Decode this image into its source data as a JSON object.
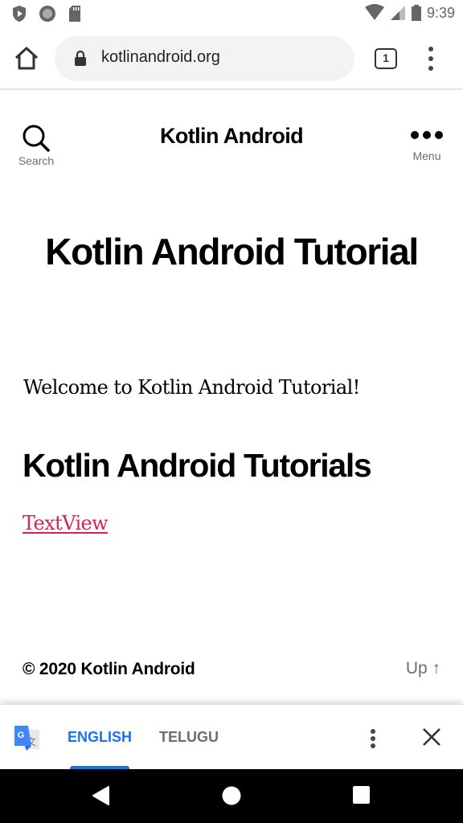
{
  "status_bar": {
    "time": "9:39",
    "left_icons": [
      "shield-play-icon",
      "circle-icon",
      "sd-card-icon"
    ],
    "right_icons": [
      "wifi-icon",
      "cell-signal-icon",
      "battery-icon"
    ]
  },
  "browser": {
    "url": "kotlinandroid.org",
    "tab_count": "1",
    "icons": [
      "home-icon",
      "lock-icon",
      "tab-switcher-icon",
      "more-vert-icon"
    ]
  },
  "site_header": {
    "search_label": "Search",
    "site_title": "Kotlin Android",
    "menu_label": "Menu"
  },
  "main": {
    "page_title": "Kotlin Android Tutorial",
    "welcome_text": "Welcome to Kotlin Android Tutorial!",
    "section_heading": "Kotlin Android Tutorials",
    "links": [
      {
        "label": "TextView"
      }
    ],
    "link_color": "#cd2653"
  },
  "footer": {
    "copyright": "© 2020 Kotlin Android",
    "up_label": "Up ↑"
  },
  "translate_bar": {
    "tabs": [
      {
        "label": "ENGLISH",
        "selected": true
      },
      {
        "label": "TELUGU",
        "selected": false
      }
    ],
    "accent_color": "#1a73e8"
  },
  "nav_bar": {
    "buttons": [
      "back",
      "home",
      "recents"
    ]
  }
}
